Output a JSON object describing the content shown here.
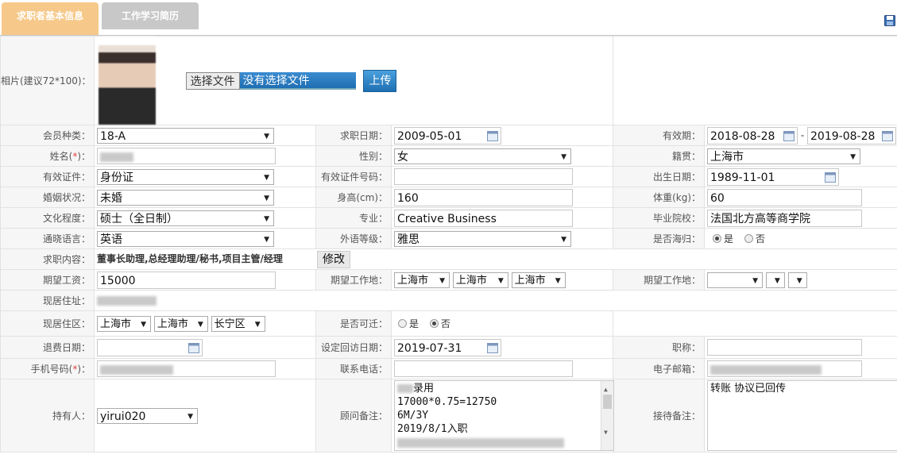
{
  "tabs": {
    "basic": "求职者基本信息",
    "work": "工作学习简历"
  },
  "photo": {
    "label": "相片(建议72*100)：",
    "choose": "选择文件",
    "no_file": "没有选择文件",
    "upload": "上传"
  },
  "labels": {
    "member_type": "会员种类：",
    "job_date": "求职日期：",
    "valid_period": "有效期：",
    "name_pre": "姓名(",
    "name_req": "*",
    "name_post": ")：",
    "gender": "性别：",
    "native": "籍贯：",
    "id_type": "有效证件：",
    "id_no": "有效证件号码：",
    "birth": "出生日期：",
    "marital": "婚姻状况：",
    "height": "身高(cm)：",
    "weight": "体重(kg)：",
    "education": "文化程度：",
    "major": "专业：",
    "school": "毕业院校：",
    "language": "通晓语言：",
    "foreign_level": "外语等级：",
    "returnee": "是否海归：",
    "job_content": "求职内容：",
    "salary": "期望工资：",
    "work_place": "期望工作地：",
    "work_place2": "期望工作地：",
    "address": "现居住址：",
    "area": "现居住区：",
    "relocate": "是否可迁：",
    "expire_date": "退费日期：",
    "visit_date": "设定回访日期：",
    "title": "职称：",
    "mobile_pre": "手机号码(",
    "mobile_req": "*",
    "mobile_post": ")：",
    "phone": "联系电话：",
    "email": "电子邮箱：",
    "holder": "持有人：",
    "consultant_note": "顾问备注：",
    "reception_note": "接待备注："
  },
  "values": {
    "member_type": "18-A",
    "job_date": "2009-05-01",
    "valid_from": "2018-08-28",
    "valid_sep": "-",
    "valid_to": "2019-08-28",
    "gender": "女",
    "native": "上海市",
    "id_type": "身份证",
    "birth": "1989-11-01",
    "marital": "未婚",
    "height": "160",
    "weight": "60",
    "education": "硕士（全日制）",
    "major": "Creative Business",
    "school": "法国北方高等商学院",
    "language": "英语",
    "foreign_level": "雅思",
    "returnee_yes": "是",
    "returnee_no": "否",
    "job_content": "董事长助理,总经理助理/秘书,项目主管/经理",
    "modify": "修改",
    "salary": "15000",
    "wp1": "上海市",
    "wp2": "上海市",
    "wp3": "上海市",
    "area1": "上海市",
    "area2": "上海市",
    "area3": "长宁区",
    "relocate_yes": "是",
    "relocate_no": "否",
    "visit_date": "2019-07-31",
    "holder": "yirui020",
    "consultant_note": [
      "录用",
      "17000*0.75=12750",
      "6M/3Y",
      "2019/8/1入职"
    ],
    "reception_note": "转账 协议已回传"
  },
  "states": {
    "returnee": "yes",
    "relocate": "no"
  },
  "colors": {
    "tab_active": "#f6c98a",
    "tab_inactive": "#c8c8c8",
    "upload_button": "#2f84c6"
  }
}
